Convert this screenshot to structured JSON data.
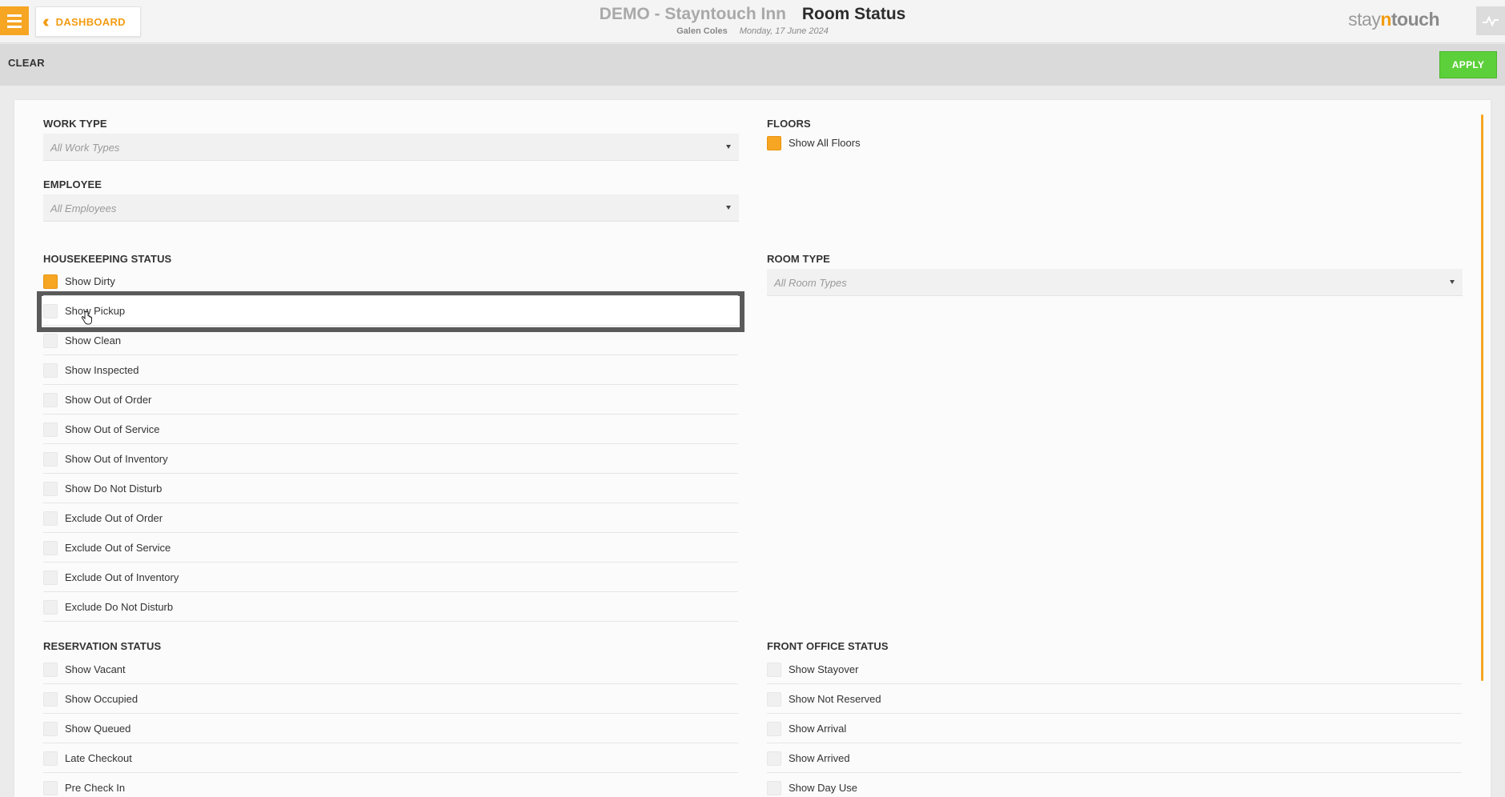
{
  "header": {
    "dashboard_label": "DASHBOARD",
    "hotel_name": "DEMO - Stayntouch Inn",
    "page_title": "Room Status",
    "user_name": "Galen Coles",
    "date": "Monday, 17 June 2024",
    "brand": {
      "part1": "stay",
      "part2": "n",
      "part3": "touch"
    }
  },
  "actions": {
    "clear_label": "CLEAR",
    "apply_label": "APPLY"
  },
  "filters": {
    "work_type": {
      "label": "WORK TYPE",
      "placeholder": "All Work Types"
    },
    "employee": {
      "label": "EMPLOYEE",
      "placeholder": "All Employees"
    },
    "floors": {
      "label": "FLOORS",
      "option": "Show All Floors"
    },
    "room_type": {
      "label": "ROOM TYPE",
      "placeholder": "All Room Types"
    },
    "housekeeping": {
      "label": "HOUSEKEEPING STATUS",
      "items": [
        "Show Dirty",
        "Show Pickup",
        "Show Clean",
        "Show Inspected",
        "Show Out of Order",
        "Show Out of Service",
        "Show Out of Inventory",
        "Show Do Not Disturb",
        "Exclude Out of Order",
        "Exclude Out of Service",
        "Exclude Out of Inventory",
        "Exclude Do Not Disturb"
      ]
    },
    "reservation": {
      "label": "RESERVATION STATUS",
      "items": [
        "Show Vacant",
        "Show Occupied",
        "Show Queued",
        "Late Checkout",
        "Pre Check In"
      ]
    },
    "front_office": {
      "label": "FRONT OFFICE STATUS",
      "items": [
        "Show Stayover",
        "Show Not Reserved",
        "Show Arrival",
        "Show Arrived",
        "Show Day Use"
      ]
    }
  },
  "colors": {
    "accent": "#f6a623",
    "apply": "#5cd03a",
    "focus_frame": "#5a5a5a"
  }
}
